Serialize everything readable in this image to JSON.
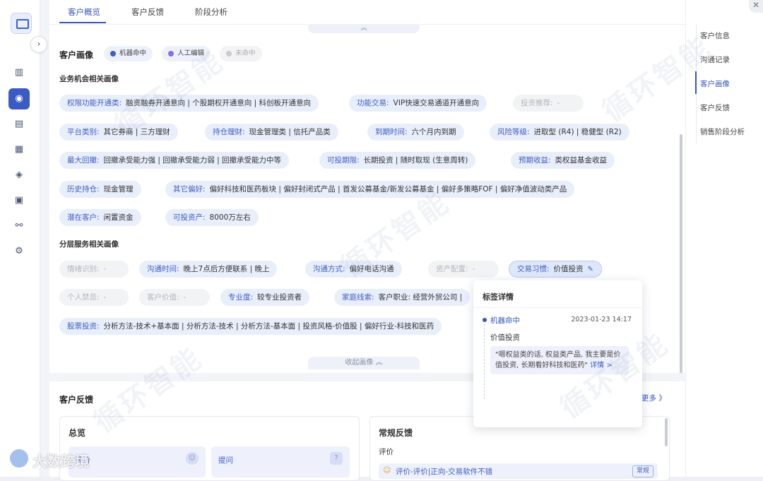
{
  "tabs": [
    "客户概览",
    "客户反馈",
    "阶段分析"
  ],
  "portrait": {
    "title": "客户画像",
    "legend": [
      {
        "label": "机器命中",
        "color": "#3d5fc9"
      },
      {
        "label": "人工编辑",
        "color": "#8a6ee0"
      },
      {
        "label": "未命中",
        "color": "#c9cbd1"
      }
    ],
    "business_title": "业务机会相关画像",
    "business_rows": [
      [
        {
          "key": "权限功能开通类:",
          "value": "融资融券开通意向 | 个股期权开通意向 | 科创板开通意向"
        },
        {
          "key": "功能交易:",
          "value": "VIP快速交易通道开通意向"
        },
        {
          "key": "投资推荐:",
          "value": "-",
          "off": true
        }
      ],
      [
        {
          "key": "平台类别:",
          "value": "其它券商 | 三方理财"
        },
        {
          "key": "持仓理财:",
          "value": "现金管理类 | 信托产品类"
        },
        {
          "key": "到期时间:",
          "value": "六个月内到期"
        },
        {
          "key": "风险等级:",
          "value": "进取型 (R4) | 稳健型 (R2)"
        }
      ],
      [
        {
          "key": "最大回撤:",
          "value": "回撤承受能力强 | 回撤承受能力弱 | 回撤承受能力中等"
        },
        {
          "key": "可投期限:",
          "value": "长期投资 | 随时取现 (生意周转)"
        },
        {
          "key": "预期收益:",
          "value": "类权益基金收益"
        }
      ],
      [
        {
          "key": "历史持仓:",
          "value": "现金管理"
        },
        {
          "key": "其它偏好:",
          "value": "偏好科技和医药板块 | 偏好封闭式产品 | 首发公募基金/新发公募基金 | 偏好多策略FOF | 偏好净值波动类产品"
        }
      ],
      [
        {
          "key": "潜在客户:",
          "value": "闲置资金"
        },
        {
          "key": "可投资产:",
          "value": "8000万左右"
        }
      ]
    ],
    "service_title": "分层服务相关画像",
    "service_rows": [
      [
        {
          "key": "情绪识别:",
          "value": "-",
          "off": true
        },
        {
          "key": "沟通时间:",
          "value": "晚上7点后方便联系 | 晚上"
        },
        {
          "key": "沟通方式:",
          "value": "偏好电话沟通"
        },
        {
          "key": "资产配置:",
          "value": "-",
          "off": true
        },
        {
          "key": "交易习惯:",
          "value": "价值投资",
          "selected": true
        }
      ],
      [
        {
          "key": "个人禁忌:",
          "value": "-",
          "off": true
        },
        {
          "key": "客户价值:",
          "value": "-",
          "off": true
        },
        {
          "key": "专业度:",
          "value": "较专业投资者"
        },
        {
          "key": "家庭线索:",
          "value": "客户职业: 经营外贸公司 |"
        }
      ],
      [
        {
          "key": "股票投资:",
          "value": "分析方法-技术+基本面 | 分析方法-技术 | 分析方法-基本面 | 投资风格-价值股 | 偏好行业-科技和医药"
        }
      ]
    ],
    "collapse_label": "收起画像 ︽",
    "expand_icon": "︽"
  },
  "popover": {
    "title": "标签详情",
    "source": "机器命中",
    "time": "2023-01-23 14:17",
    "value": "价值投资",
    "quote": "\"嗯权益类的话, 权益类产品, 我主要是价值投资, 长期看好科技和医药\"",
    "detail_link": "详情 >"
  },
  "feedback": {
    "title": "客户反馈",
    "more": "更多 》",
    "overview_title": "总览",
    "overview_items": [
      "评价",
      "提问"
    ],
    "regular_title": "常规反馈",
    "regular_sub": "评价",
    "regular_item": "评价-评价|正向-交易软件不错",
    "regular_badge": "常规"
  },
  "right_nav": [
    "客户信息",
    "沟通记录",
    "客户画像",
    "客户反馈",
    "销售阶段分析"
  ],
  "right_nav_active": "客户画像",
  "watermark": "循环智能",
  "corner_watermark": "大数跨境"
}
